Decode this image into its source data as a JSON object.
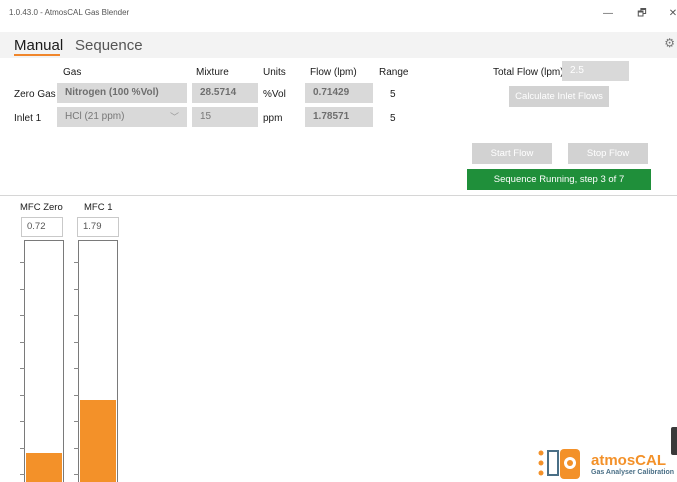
{
  "window": {
    "title": "1.0.43.0 - AtmosCAL Gas Blender",
    "minimize": "—",
    "restore": "🗗",
    "close": "✕"
  },
  "tabs": [
    {
      "label": "Manual",
      "active": true
    },
    {
      "label": "Sequence",
      "active": false
    }
  ],
  "settings_icon": "gear-icon",
  "table": {
    "headers": {
      "gas": "Gas",
      "mixture": "Mixture",
      "units": "Units",
      "flow": "Flow (lpm)",
      "range": "Range"
    },
    "rows": [
      {
        "label": "Zero Gas",
        "gas": "Nitrogen (100 %Vol)",
        "mixture": "28.5714",
        "units": "%Vol",
        "flow": "0.71429",
        "range": "5"
      },
      {
        "label": "Inlet 1",
        "gas": "HCl (21 ppm)",
        "mixture": "15",
        "units": "ppm",
        "flow": "1.78571",
        "range": "5"
      }
    ]
  },
  "total_flow": {
    "label": "Total Flow (lpm)",
    "value": "2.5"
  },
  "buttons": {
    "calculate": "Calculate Inlet Flows",
    "start": "Start Flow",
    "stop": "Stop Flow"
  },
  "status": {
    "text": "Sequence Running, step 3 of 7",
    "color": "#1f8f3a"
  },
  "mfcs": [
    {
      "label": "MFC Zero",
      "value": "0.72",
      "fill_fraction": 0.144
    },
    {
      "label": "MFC 1",
      "value": "1.79",
      "fill_fraction": 0.357
    }
  ],
  "logo": {
    "name": "atmosCAL",
    "tagline": "Gas Analyser Calibration"
  },
  "colors": {
    "accent": "#f39129",
    "status_green": "#1f8f3a",
    "disabled_button": "#d2d2d2"
  }
}
